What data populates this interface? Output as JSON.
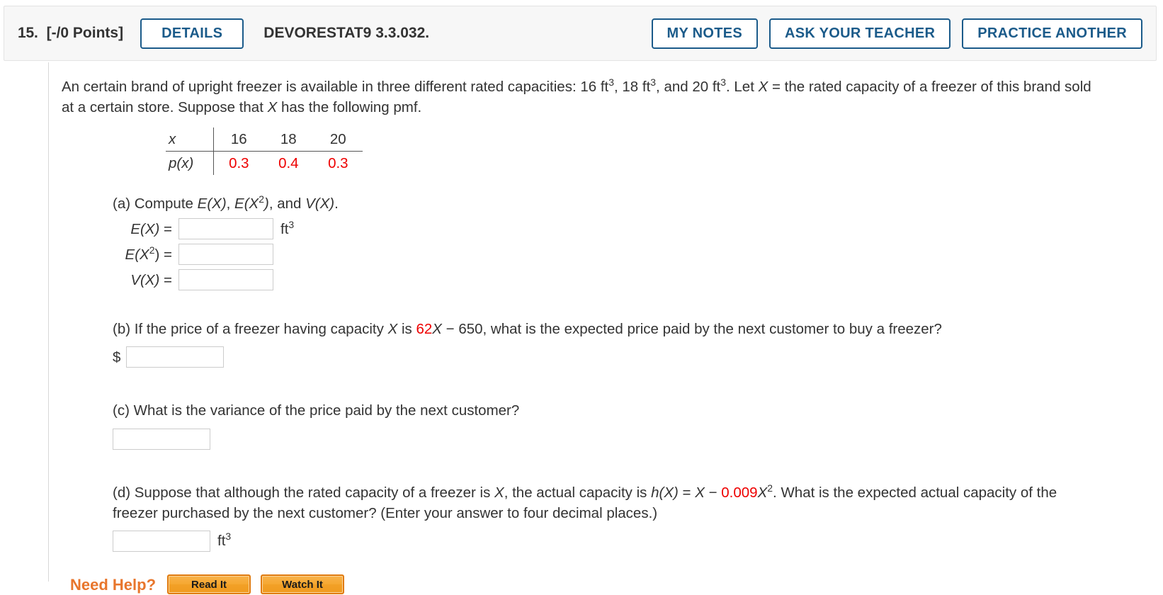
{
  "header": {
    "question_number": "15.",
    "points": "[-/0 Points]",
    "details_label": "DETAILS",
    "textbook_code": "DEVORESTAT9 3.3.032.",
    "my_notes_label": "MY NOTES",
    "ask_teacher_label": "ASK YOUR TEACHER",
    "practice_another_label": "PRACTICE ANOTHER"
  },
  "colors": {
    "accent_blue": "#1b5b8a",
    "red": "#ee0000",
    "orange": "#e8762c",
    "header_bg": "#f7f7f7"
  },
  "stem": {
    "line1_a": "An certain brand of upright freezer is available in three different rated capacities: 16 ft",
    "line1_b": ", 18 ft",
    "line1_c": ", and 20 ft",
    "line1_d": ". Let ",
    "var_X": "X",
    "line1_e": " = the rated capacity of a freezer of this brand sold at a certain store. Suppose that ",
    "line1_f": " has the following pmf.",
    "exp3": "3"
  },
  "pmf_table": {
    "row_x_label": "x",
    "row_p_label": "p(x)",
    "x_values": [
      "16",
      "18",
      "20"
    ],
    "p_values": [
      "0.3",
      "0.4",
      "0.3"
    ]
  },
  "parts": {
    "a": {
      "prompt_pre": "(a) Compute ",
      "prompt_ex": "E(X)",
      "prompt_mid": ", ",
      "prompt_ex2_a": "E(X",
      "prompt_ex2_sup": "2",
      "prompt_ex2_b": ")",
      "prompt_and": ", and ",
      "prompt_vx": "V(X)",
      "prompt_end": ".",
      "rows": [
        {
          "label_main": "E(X)",
          "label_sup": "",
          "eq": " =",
          "value": "",
          "placeholder": "",
          "unit": "ft",
          "unit_sup": "3"
        },
        {
          "label_main": "E(X",
          "label_sup": "2",
          "eq": ") =",
          "value": "",
          "placeholder": "",
          "unit": "",
          "unit_sup": ""
        },
        {
          "label_main": "V(X)",
          "label_sup": "",
          "eq": " =",
          "value": "",
          "placeholder": "",
          "unit": "",
          "unit_sup": ""
        }
      ]
    },
    "b": {
      "text_pre": "(b) If the price of a freezer having capacity ",
      "var_X": "X",
      "text_mid": " is ",
      "coef_red": "62",
      "coef_var": "X",
      "text_after": " − 650, what is the expected price paid by the next customer to buy a freezer?",
      "dollar": "$",
      "value": "",
      "placeholder": ""
    },
    "c": {
      "text": "(c) What is the variance of the price paid by the next customer?",
      "value": "",
      "placeholder": ""
    },
    "d": {
      "text_pre": "(d) Suppose that although the rated capacity of a freezer is ",
      "var_X": "X",
      "text_mid": ", the actual capacity is ",
      "h_fn": "h(X)",
      "eq": " = ",
      "var_X2": "X",
      "minus": " − ",
      "coef_red": "0.009",
      "coef_var": "X",
      "coef_sup": "2",
      "text_after": ". What is the expected actual capacity of the freezer purchased by the next customer? (Enter your answer to four decimal places.)",
      "value": "",
      "placeholder": "",
      "unit": "ft",
      "unit_sup": "3"
    }
  },
  "need_help": {
    "label": "Need Help?",
    "read_it": "Read It",
    "watch_it": "Watch It"
  }
}
